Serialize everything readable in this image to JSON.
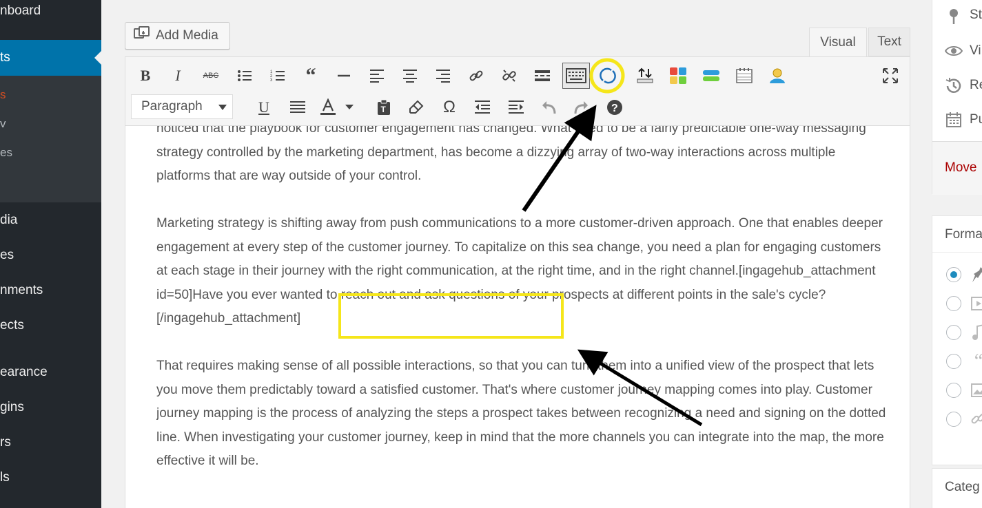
{
  "sidebar": {
    "items": [
      {
        "label": "nboard"
      },
      {
        "label": "ts"
      },
      {
        "label": "dia"
      },
      {
        "label": "es"
      },
      {
        "label": "nments"
      },
      {
        "label": "ects"
      },
      {
        "label": "earance"
      },
      {
        "label": "gins"
      },
      {
        "label": "rs"
      },
      {
        "label": "ls"
      }
    ],
    "submenu": [
      "s",
      "v",
      "es"
    ]
  },
  "editor": {
    "add_media_label": "Add Media",
    "tabs": {
      "visual": "Visual",
      "text": "Text"
    },
    "format_select_value": "Paragraph",
    "content": {
      "p1": "noticed that the playbook for customer engagement has changed. What used to be a fairly predictable one-way messaging strategy controlled by the marketing department, has become a dizzying array of two-way interactions across multiple platforms that are way outside of your control.",
      "p2": "Marketing strategy is shifting away from push communications to a more customer-driven approach. One that enables deeper engagement at every step of the customer journey. To capitalize on this sea change, you need a plan for engaging customers at each stage in their journey with the right communication, at the right time, and in the right channel.[ingagehub_attachment id=50]Have you ever wanted to reach out and ask questions of your prospects at different points in the sale's cycle?[/ingagehub_attachment]",
      "p3": "That requires making sense of all possible interactions, so that you can turn them into a unified view of the prospect that lets you move them predictably toward a satisfied customer. That's where customer journey mapping comes into play. Customer journey mapping is the process of analyzing the steps a prospect takes between recognizing a need and signing on the dotted line. When investigating your customer journey, keep in mind that the more channels you can integrate into the map, the more effective it will be."
    }
  },
  "publish_box": {
    "status_label": "St",
    "visibility_label": "Vi",
    "revisions_label": "Re",
    "publish_label": "Pu",
    "move_trash_label": "Move"
  },
  "format_box": {
    "title": "Forma"
  },
  "categories_box": {
    "title": "Categ"
  },
  "colors": {
    "admin_bg": "#23282d",
    "admin_accent": "#0073aa",
    "highlight_yellow": "#f5e61a",
    "trash_red": "#a00"
  }
}
